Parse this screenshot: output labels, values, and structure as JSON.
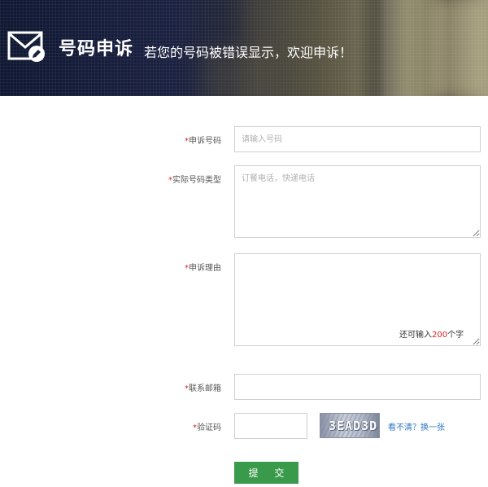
{
  "header": {
    "title": "号码申诉",
    "subtitle": "若您的号码被错误显示，欢迎申诉！",
    "icon": "mail-edit-icon"
  },
  "form": {
    "required_mark": "*",
    "phone": {
      "label": "申诉号码",
      "placeholder": "请输入号码",
      "value": ""
    },
    "type": {
      "label": "实际号码类型",
      "placeholder": "订餐电话，快递电话",
      "value": ""
    },
    "reason": {
      "label": "申诉理由",
      "value": "",
      "counter_prefix": "还可输入",
      "counter_value": "200",
      "counter_suffix": "个字"
    },
    "email": {
      "label": "联系邮箱",
      "value": ""
    },
    "captcha": {
      "label": "验证码",
      "value": "",
      "image_text": "3EAD3D",
      "refresh_label": "看不清？换一张"
    },
    "submit_label": "提 交"
  },
  "colors": {
    "required": "#e02020",
    "submit_bg": "#3a9a4c",
    "link": "#2f78c4",
    "field_border": "#cfcfcf"
  }
}
